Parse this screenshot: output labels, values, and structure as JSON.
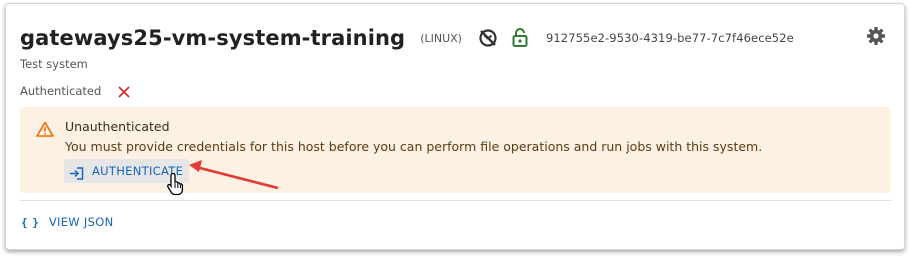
{
  "system": {
    "name": "gateways25-vm-system-training",
    "os": "(LINUX)",
    "uuid": "912755e2-9530-4319-be77-7c7f46ece52e",
    "description": "Test system",
    "auth_label": "Authenticated",
    "icons": [
      "ssh-disabled-icon",
      "lock-open-icon",
      "gear-icon",
      "close-x-icon"
    ]
  },
  "alert": {
    "title": "Unauthenticated",
    "message": "You must provide credentials for this host before you can perform file operations and run jobs with this system.",
    "button_label": "AUTHENTICATE",
    "icons": [
      "warning-icon",
      "login-icon"
    ]
  },
  "footer": {
    "view_json_label": "VIEW JSON",
    "braces": "{ }"
  },
  "colors": {
    "accent": "#1565c0",
    "lock": "#2e7d32",
    "error": "#d32f2f",
    "warning": "#ef6c00",
    "alert_bg": "#fdf1e4",
    "annotation_arrow": "#e53935"
  }
}
